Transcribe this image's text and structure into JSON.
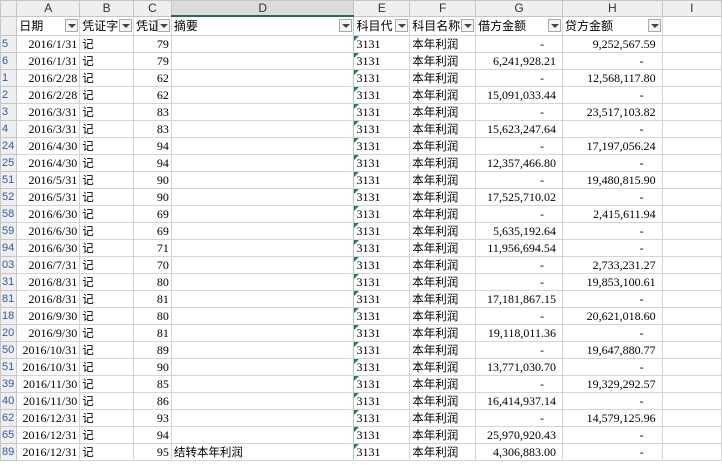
{
  "columns": [
    "A",
    "B",
    "C",
    "D",
    "E",
    "F",
    "G",
    "H",
    "I"
  ],
  "headers": [
    "日期",
    "凭证字",
    "凭证",
    "摘要",
    "科目代",
    "科目名称",
    "借方金额",
    "贷方金额"
  ],
  "rows": [
    {
      "r": "5",
      "date": "2016/1/31",
      "v": "记",
      "no": "79",
      "memo": "",
      "code": "3131",
      "name": "本年利润",
      "debit": "-",
      "credit": "9,252,567.59"
    },
    {
      "r": "6",
      "date": "2016/1/31",
      "v": "记",
      "no": "79",
      "memo": "",
      "code": "3131",
      "name": "本年利润",
      "debit": "6,241,928.21",
      "credit": "-"
    },
    {
      "r": "1",
      "date": "2016/2/28",
      "v": "记",
      "no": "62",
      "memo": "",
      "code": "3131",
      "name": "本年利润",
      "debit": "-",
      "credit": "12,568,117.80"
    },
    {
      "r": "2",
      "date": "2016/2/28",
      "v": "记",
      "no": "62",
      "memo": "",
      "code": "3131",
      "name": "本年利润",
      "debit": "15,091,033.44",
      "credit": "-"
    },
    {
      "r": "3",
      "date": "2016/3/31",
      "v": "记",
      "no": "83",
      "memo": "",
      "code": "3131",
      "name": "本年利润",
      "debit": "-",
      "credit": "23,517,103.82"
    },
    {
      "r": "4",
      "date": "2016/3/31",
      "v": "记",
      "no": "83",
      "memo": "",
      "code": "3131",
      "name": "本年利润",
      "debit": "15,623,247.64",
      "credit": "-"
    },
    {
      "r": "24",
      "date": "2016/4/30",
      "v": "记",
      "no": "94",
      "memo": "",
      "code": "3131",
      "name": "本年利润",
      "debit": "-",
      "credit": "17,197,056.24"
    },
    {
      "r": "25",
      "date": "2016/4/30",
      "v": "记",
      "no": "94",
      "memo": "",
      "code": "3131",
      "name": "本年利润",
      "debit": "12,357,466.80",
      "credit": "-"
    },
    {
      "r": "51",
      "date": "2016/5/31",
      "v": "记",
      "no": "90",
      "memo": "",
      "code": "3131",
      "name": "本年利润",
      "debit": "-",
      "credit": "19,480,815.90"
    },
    {
      "r": "52",
      "date": "2016/5/31",
      "v": "记",
      "no": "90",
      "memo": "",
      "code": "3131",
      "name": "本年利润",
      "debit": "17,525,710.02",
      "credit": "-"
    },
    {
      "r": "58",
      "date": "2016/6/30",
      "v": "记",
      "no": "69",
      "memo": "",
      "code": "3131",
      "name": "本年利润",
      "debit": "-",
      "credit": "2,415,611.94"
    },
    {
      "r": "59",
      "date": "2016/6/30",
      "v": "记",
      "no": "69",
      "memo": "",
      "code": "3131",
      "name": "本年利润",
      "debit": "5,635,192.64",
      "credit": "-"
    },
    {
      "r": "94",
      "date": "2016/6/30",
      "v": "记",
      "no": "71",
      "memo": "",
      "code": "3131",
      "name": "本年利润",
      "debit": "11,956,694.54",
      "credit": "-"
    },
    {
      "r": "03",
      "date": "2016/7/31",
      "v": "记",
      "no": "70",
      "memo": "",
      "code": "3131",
      "name": "本年利润",
      "debit": "-",
      "credit": "2,733,231.27"
    },
    {
      "r": "31",
      "date": "2016/8/31",
      "v": "记",
      "no": "80",
      "memo": "",
      "code": "3131",
      "name": "本年利润",
      "debit": "-",
      "credit": "19,853,100.61"
    },
    {
      "r": "81",
      "date": "2016/8/31",
      "v": "记",
      "no": "81",
      "memo": "",
      "code": "3131",
      "name": "本年利润",
      "debit": "17,181,867.15",
      "credit": "-"
    },
    {
      "r": "18",
      "date": "2016/9/30",
      "v": "记",
      "no": "80",
      "memo": "",
      "code": "3131",
      "name": "本年利润",
      "debit": "-",
      "credit": "20,621,018.60"
    },
    {
      "r": "20",
      "date": "2016/9/30",
      "v": "记",
      "no": "81",
      "memo": "",
      "code": "3131",
      "name": "本年利润",
      "debit": "19,118,011.36",
      "credit": "-"
    },
    {
      "r": "50",
      "date": "2016/10/31",
      "v": "记",
      "no": "89",
      "memo": "",
      "code": "3131",
      "name": "本年利润",
      "debit": "-",
      "credit": "19,647,880.77"
    },
    {
      "r": "51",
      "date": "2016/10/31",
      "v": "记",
      "no": "90",
      "memo": "",
      "code": "3131",
      "name": "本年利润",
      "debit": "13,771,030.70",
      "credit": "-"
    },
    {
      "r": "39",
      "date": "2016/11/30",
      "v": "记",
      "no": "85",
      "memo": "",
      "code": "3131",
      "name": "本年利润",
      "debit": "-",
      "credit": "19,329,292.57"
    },
    {
      "r": "40",
      "date": "2016/11/30",
      "v": "记",
      "no": "86",
      "memo": "",
      "code": "3131",
      "name": "本年利润",
      "debit": "16,414,937.14",
      "credit": "-"
    },
    {
      "r": "62",
      "date": "2016/12/31",
      "v": "记",
      "no": "93",
      "memo": "",
      "code": "3131",
      "name": "本年利润",
      "debit": "-",
      "credit": "14,579,125.96"
    },
    {
      "r": "65",
      "date": "2016/12/31",
      "v": "记",
      "no": "94",
      "memo": "",
      "code": "3131",
      "name": "本年利润",
      "debit": "25,970,920.43",
      "credit": "-"
    },
    {
      "r": "89",
      "date": "2016/12/31",
      "v": "记",
      "no": "95",
      "memo": "结转本年利润",
      "code": "3131",
      "name": "本年利润",
      "debit": "4,306,883.00",
      "credit": "-"
    }
  ]
}
